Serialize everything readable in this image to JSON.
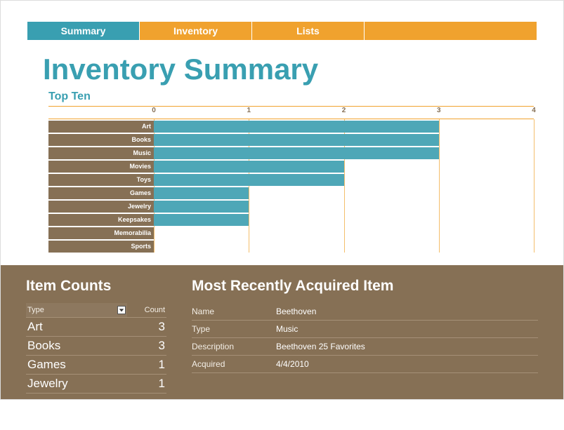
{
  "tabs": [
    {
      "label": "Summary",
      "active": true
    },
    {
      "label": "Inventory",
      "active": false
    },
    {
      "label": "Lists",
      "active": false
    }
  ],
  "title": "Inventory Summary",
  "chart_title": "Top Ten",
  "chart_data": {
    "type": "bar",
    "orientation": "horizontal",
    "title": "Top Ten",
    "xlabel": "",
    "ylabel": "",
    "xlim": [
      0,
      4
    ],
    "xticks": [
      0,
      1,
      2,
      3,
      4
    ],
    "categories": [
      "Art",
      "Books",
      "Music",
      "Movies",
      "Toys",
      "Games",
      "Jewelry",
      "Keepsakes",
      "Memorabilia",
      "Sports"
    ],
    "values": [
      3,
      3,
      3,
      2,
      2,
      1,
      1,
      1,
      0,
      0
    ]
  },
  "item_counts": {
    "title": "Item Counts",
    "headers": {
      "type": "Type",
      "count": "Count"
    },
    "rows": [
      {
        "type": "Art",
        "count": 3
      },
      {
        "type": "Books",
        "count": 3
      },
      {
        "type": "Games",
        "count": 1
      },
      {
        "type": "Jewelry",
        "count": 1
      }
    ]
  },
  "recent": {
    "title": "Most Recently Acquired Item",
    "labels": {
      "name": "Name",
      "type": "Type",
      "description": "Description",
      "acquired": "Acquired"
    },
    "values": {
      "name": "Beethoven",
      "type": "Music",
      "description": "Beethoven 25 Favorites",
      "acquired": "4/4/2010"
    }
  }
}
